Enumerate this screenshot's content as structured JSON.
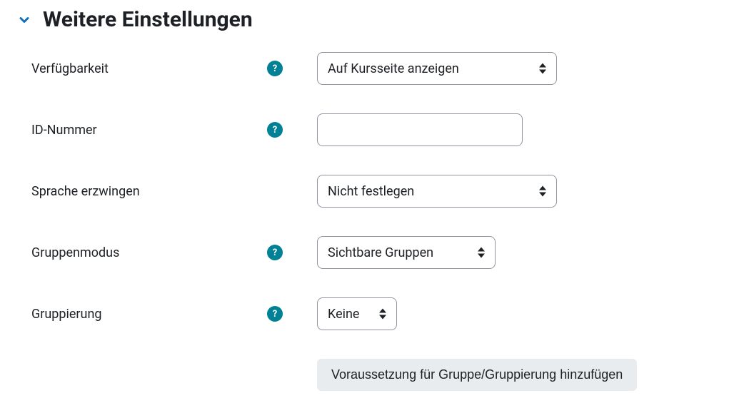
{
  "section": {
    "title": "Weitere Einstellungen"
  },
  "fields": {
    "availability": {
      "label": "Verfügbarkeit",
      "value": "Auf Kursseite anzeigen"
    },
    "idnumber": {
      "label": "ID-Nummer",
      "value": ""
    },
    "forcelang": {
      "label": "Sprache erzwingen",
      "value": "Nicht festlegen"
    },
    "groupmode": {
      "label": "Gruppenmodus",
      "value": "Sichtbare Gruppen"
    },
    "grouping": {
      "label": "Gruppierung",
      "value": "Keine"
    }
  },
  "buttons": {
    "add_restriction": "Voraussetzung für Gruppe/Gruppierung hinzufügen"
  }
}
